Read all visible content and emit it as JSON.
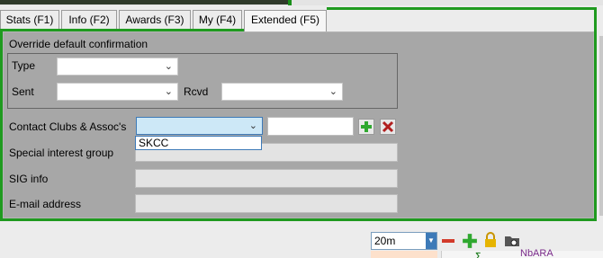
{
  "tabs": [
    {
      "label": "Stats (F1)"
    },
    {
      "label": "Info (F2)"
    },
    {
      "label": "Awards (F3)"
    },
    {
      "label": "My (F4)"
    },
    {
      "label": "Extended (F5)",
      "active": true
    }
  ],
  "confirmation": {
    "group_title": "Override default confirmation",
    "type_label": "Type",
    "type_value": "",
    "sent_label": "Sent",
    "sent_value": "",
    "rcvd_label": "Rcvd",
    "rcvd_value": ""
  },
  "clubs": {
    "label": "Contact Clubs & Assoc's",
    "selected": "",
    "number_value": "",
    "options": [
      "SKCC"
    ]
  },
  "fields": {
    "sig_label": "Special interest group",
    "sig_value": "",
    "sig_info_label": "SIG info",
    "sig_info_value": "",
    "email_label": "E-mail address",
    "email_value": ""
  },
  "footer": {
    "band_value": "20m",
    "call_partial": "NbARA"
  },
  "icons": {
    "add": "plus-icon",
    "delete": "x-icon",
    "remove": "minus-icon",
    "lock": "lock-icon",
    "folder": "folder-icon"
  },
  "colors": {
    "frame_green": "#1f9a1f",
    "panel_gray": "#a7a7a7",
    "focus_blue": "#cde8f7",
    "delete_red": "#b11e1e",
    "add_green": "#2fa82f",
    "lock_yellow": "#e6b400"
  }
}
